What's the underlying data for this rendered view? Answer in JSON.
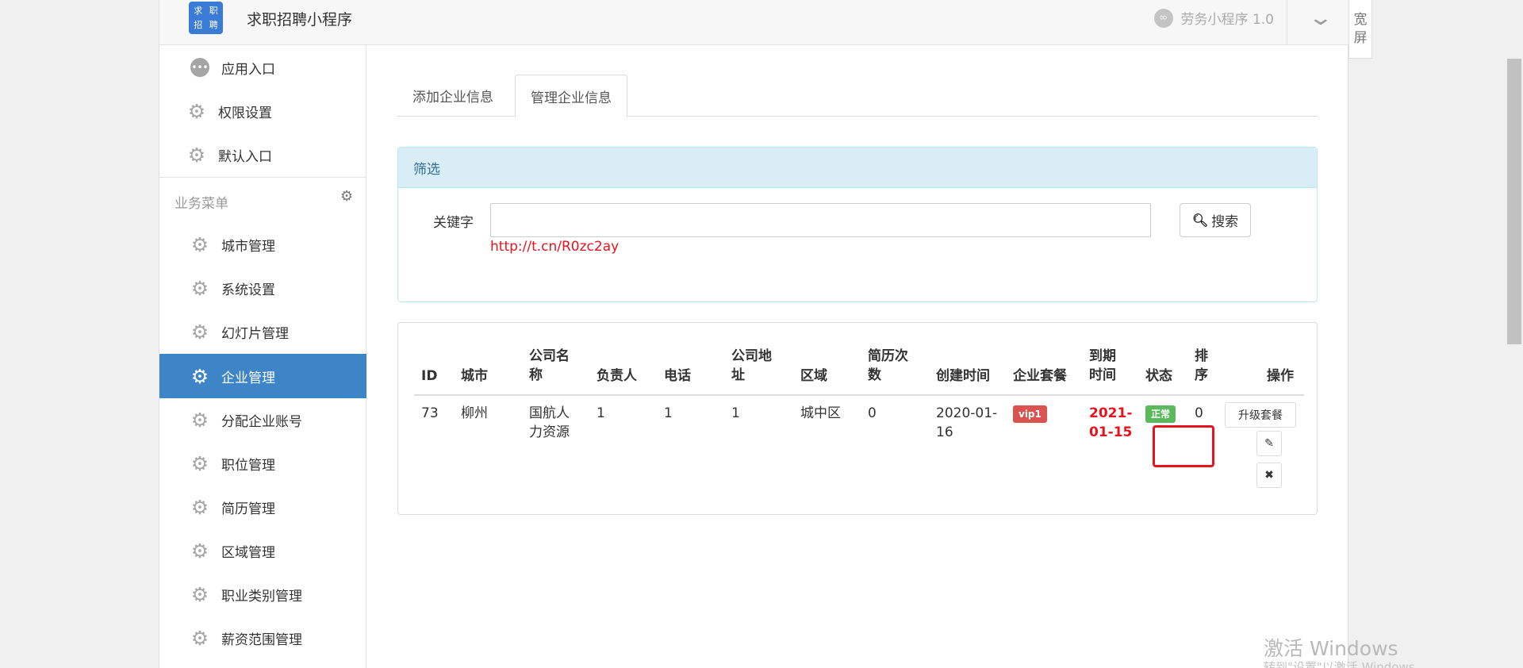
{
  "header": {
    "logo": [
      "求",
      "职",
      "招",
      "聘"
    ],
    "title": "求职招聘小程序",
    "version": "劳务小程序 1.0"
  },
  "wide_toggle": [
    "宽",
    "屏"
  ],
  "sidebar": {
    "top_items": [
      {
        "label": "应用入口",
        "icon": "chat-icon"
      },
      {
        "label": "权限设置",
        "icon": "gear-icon"
      },
      {
        "label": "默认入口",
        "icon": "gear-icon"
      }
    ],
    "group_label": "业务菜单",
    "items": [
      {
        "label": "城市管理",
        "icon": "gear-icon"
      },
      {
        "label": "系统设置",
        "icon": "gear-icon"
      },
      {
        "label": "幻灯片管理",
        "icon": "gear-icon"
      },
      {
        "label": "企业管理",
        "icon": "gear-icon",
        "active": true
      },
      {
        "label": "分配企业账号",
        "icon": "gear-icon"
      },
      {
        "label": "职位管理",
        "icon": "gear-icon"
      },
      {
        "label": "简历管理",
        "icon": "gear-icon"
      },
      {
        "label": "区域管理",
        "icon": "gear-icon"
      },
      {
        "label": "职业类别管理",
        "icon": "gear-icon"
      },
      {
        "label": "薪资范围管理",
        "icon": "gear-icon"
      }
    ]
  },
  "tabs": [
    {
      "label": "添加企业信息"
    },
    {
      "label": "管理企业信息",
      "active": true
    }
  ],
  "filter": {
    "title": "筛选",
    "keyword_label": "关键字",
    "keyword_value": "",
    "hint_url": "http://t.cn/R0zc2ay",
    "search_label": "搜索"
  },
  "table": {
    "headers": [
      "ID",
      "城市",
      "公司名称",
      "负责人",
      "电话",
      "公司地址",
      "区域",
      "简历次数",
      "创建时间",
      "企业套餐",
      "到期时间",
      "状态",
      "排序",
      "操作"
    ],
    "rows": [
      {
        "id": "73",
        "city": "柳州",
        "company": "国航人力资源",
        "owner": "1",
        "phone": "1",
        "address": "1",
        "region": "城中区",
        "resume_count": "0",
        "created": "2020-01-16",
        "plan": "vip1",
        "expires": "2021-01-15",
        "status": "正常",
        "sort": "0",
        "actions": {
          "upgrade": "升级套餐",
          "edit": "✎",
          "delete": "✖"
        }
      }
    ]
  },
  "watermark": {
    "line1": "激活 Windows",
    "line2": "转到\"设置\"以激活 Windows。"
  },
  "colors": {
    "accent": "#3d85c6",
    "danger": "#e8141d",
    "success": "#5cb85c",
    "info_bg": "#d9edf7"
  }
}
